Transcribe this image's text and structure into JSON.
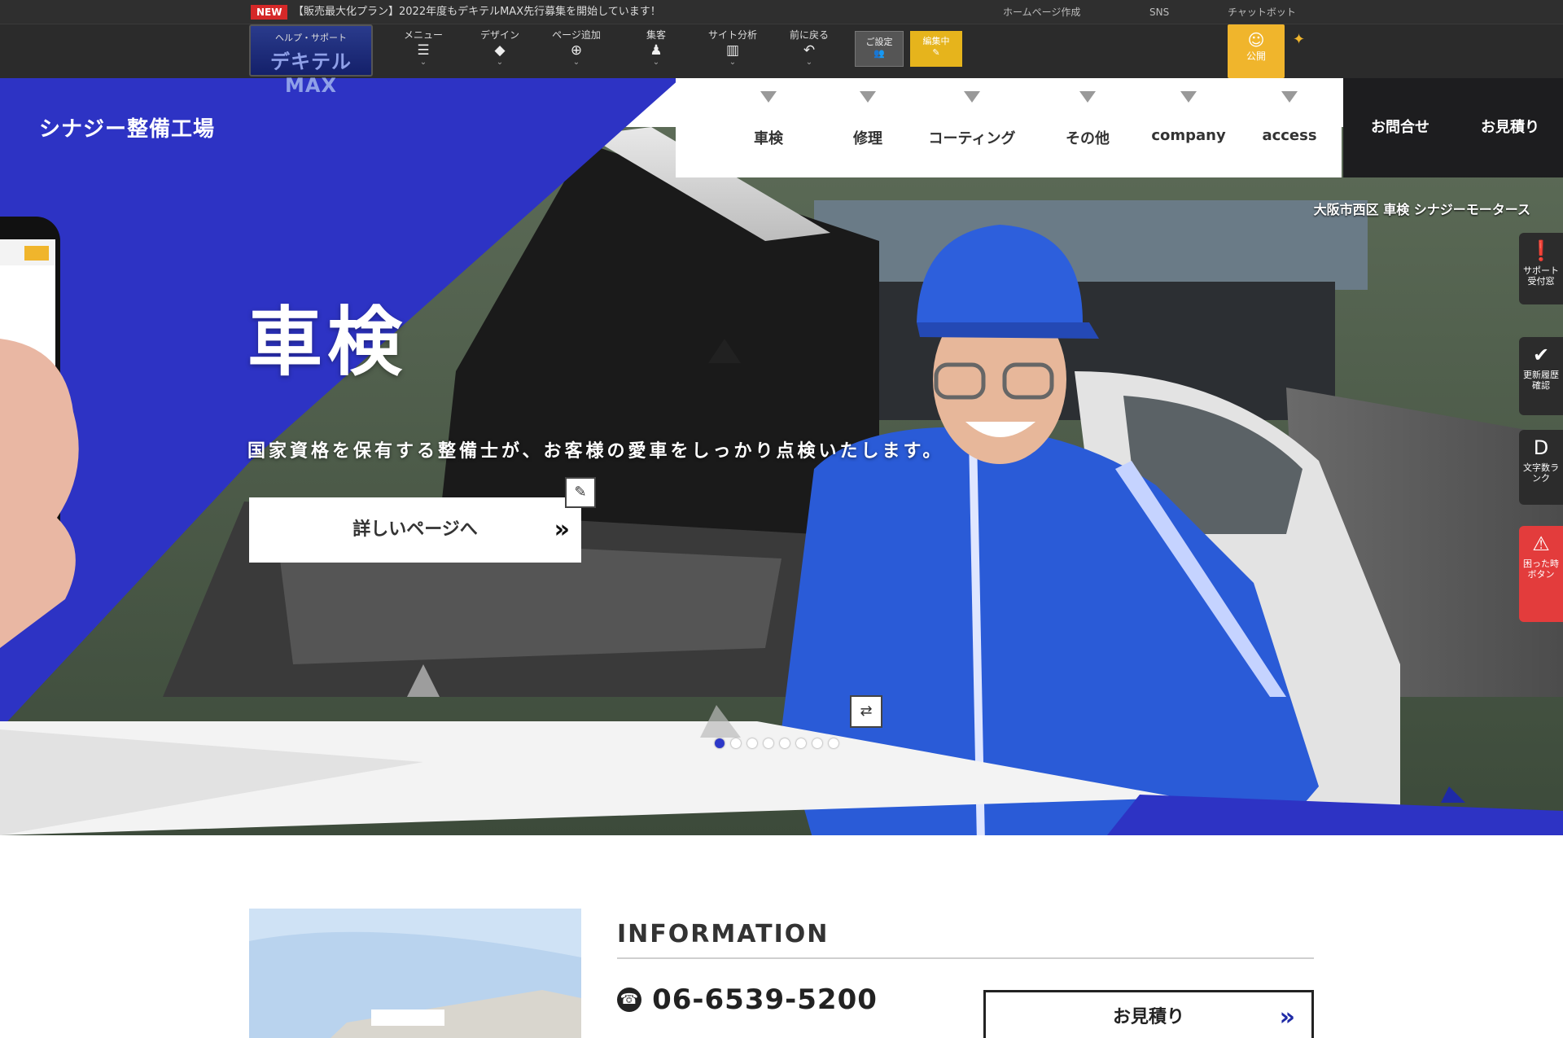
{
  "editor": {
    "new_badge": "NEW",
    "notice": "【販売最大化プラン】2022年度もデキテルMAX先行募集を開始しています！",
    "links": [
      "ホームページ作成",
      "SNS",
      "チャットボット"
    ],
    "help": {
      "label": "ヘルプ・サポート",
      "brand": "デキテルMAX"
    },
    "tools": [
      {
        "label": "メニュー",
        "icon": "menu-icon"
      },
      {
        "label": "デザイン",
        "icon": "palette-icon"
      },
      {
        "label": "ページ追加",
        "icon": "page-add-icon"
      },
      {
        "label": "集客",
        "icon": "people-icon"
      },
      {
        "label": "サイト分析",
        "icon": "chart-icon"
      },
      {
        "label": "前に戻る",
        "icon": "undo-icon"
      }
    ],
    "settings_label": "ご設定",
    "edit_label": "編集中",
    "publish_label": "公開"
  },
  "site": {
    "logo": "シナジー整備工場",
    "nav": [
      "車検",
      "修理",
      "コーティング",
      "その他",
      "company",
      "access"
    ],
    "cta_contact": "お問合せ",
    "cta_quote": "お見積り",
    "tagline": "大阪市西区 車検 シナジーモータース"
  },
  "hero": {
    "title": "車検",
    "description": "国家資格を保有する整備士が、お客様の愛車をしっかり点検いたします。",
    "button_label": "詳しいページへ",
    "slide_count": 8,
    "active_slide": 0
  },
  "side_tabs": [
    {
      "label": "サポート受付窓",
      "icon": "alert-circle-icon",
      "color": "#2c2c2c"
    },
    {
      "label": "更新履歴確認",
      "icon": "check-circle-icon",
      "color": "#2c2c2c"
    },
    {
      "label": "文字数ランク",
      "icon": "letter-d-icon",
      "color": "#2c2c2c"
    },
    {
      "label": "困った時ボタン",
      "icon": "warning-icon",
      "color": "#e33c3c"
    }
  ],
  "info": {
    "heading": "INFORMATION",
    "phone": "06-6539-5200",
    "quote_button": "お見積り"
  },
  "colors": {
    "brand_blue": "#2d33c4",
    "dark": "#1d1d1f",
    "accent_yellow": "#f0b52c",
    "alert_red": "#e33c3c"
  }
}
